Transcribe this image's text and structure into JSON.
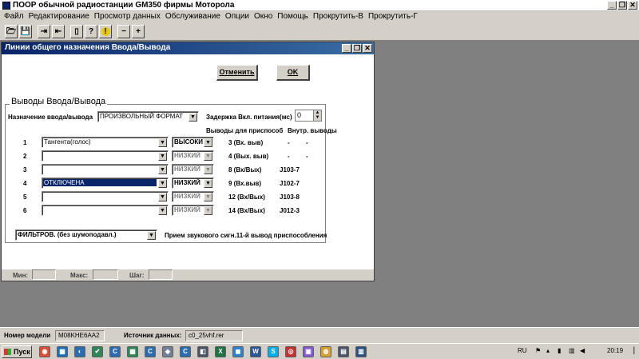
{
  "app": {
    "title": "ПООР обычной радиостанции GM350 фирмы Моторола"
  },
  "window_buttons": {
    "minimize": "_",
    "restore": "❐",
    "close": "✕"
  },
  "menu": {
    "items": [
      "Файл",
      "Редактирование",
      "Просмотр данных",
      "Обслуживание",
      "Опции",
      "Окно",
      "Помощь",
      "Прокрутить-В",
      "Прокрутить-Г"
    ]
  },
  "toolbar": {
    "buttons": [
      {
        "name": "open-icon",
        "glyph": "🗁"
      },
      {
        "name": "save-icon",
        "glyph": "💾"
      },
      {
        "name": "read-radio-icon",
        "glyph": "⇥"
      },
      {
        "name": "write-radio-icon",
        "glyph": "⇤"
      },
      {
        "name": "preview-icon",
        "glyph": "▯"
      },
      {
        "name": "help-icon",
        "glyph": "?"
      },
      {
        "name": "info-icon",
        "glyph": "!"
      },
      {
        "name": "minus-icon",
        "glyph": "−"
      },
      {
        "name": "plus-icon",
        "glyph": "+"
      }
    ]
  },
  "child_window": {
    "title": "Линии общего назначения Ввода/Вывода",
    "cancel_label": "Отменить",
    "ok_label": "OK",
    "group_title": "Выводы Ввода/Вывода",
    "purpose_label": "Назначение ввода/вывода",
    "purpose_value": "ПРОИЗВОЛЬНЫЙ ФОРМАТ",
    "delay_label": "Задержка Вкл. питания(мс)",
    "delay_value": "0",
    "accessory_pins_header": "Выводы для приспособ",
    "internal_pins_header": "Внутр. выводы",
    "rows": [
      {
        "num": "1",
        "function": "Тангента(голос)",
        "function_disabled": false,
        "function_selected": false,
        "level": "ВЫСОКИ",
        "level_disabled": false,
        "pin": "3  (Вх. выв)",
        "internal": "-",
        "internal2": "-"
      },
      {
        "num": "2",
        "function": "",
        "function_disabled": false,
        "function_selected": false,
        "level": "НИЗКИЙ",
        "level_disabled": true,
        "pin": "4  (Вых. выв)",
        "internal": "-",
        "internal2": "-"
      },
      {
        "num": "3",
        "function": "",
        "function_disabled": false,
        "function_selected": false,
        "level": "НИЗКИЙ",
        "level_disabled": true,
        "pin": "8  (Вх/Вых)",
        "internal": "J103-7",
        "internal2": ""
      },
      {
        "num": "4",
        "function": "ОТКЛЮЧЕНА",
        "function_disabled": false,
        "function_selected": true,
        "level": "НИЗКИЙ",
        "level_disabled": false,
        "pin": "9  (Вх.выв)",
        "internal": "J102-7",
        "internal2": ""
      },
      {
        "num": "5",
        "function": "",
        "function_disabled": false,
        "function_selected": false,
        "level": "НИЗКИЙ",
        "level_disabled": true,
        "pin": "12  (Вх/Вых)",
        "internal": "J103-8",
        "internal2": ""
      },
      {
        "num": "6",
        "function": "",
        "function_disabled": false,
        "function_selected": false,
        "level": "НИЗКИЙ",
        "level_disabled": true,
        "pin": "14  (Вх/Вых)",
        "internal": "J012-3",
        "internal2": ""
      }
    ],
    "filter_value": "ФИЛЬТРОВ. (без шумоподавл.)",
    "filter_caption": "Прием звукового сигн.11-й вывод приспособления",
    "min_label": "Мин:",
    "max_label": "Макс:",
    "step_label": "Шаг:"
  },
  "statusbar": {
    "model_label": "Номер модели",
    "model_value": "M08KHE6AA2",
    "source_label": "Источник данных:",
    "source_value": "c0_25vhf.rer"
  },
  "taskbar": {
    "start_label": "Пуск",
    "apps": [
      {
        "name": "chrome-icon",
        "glyph": "◉",
        "color": "#dd4b39"
      },
      {
        "name": "app-icon",
        "glyph": "▦",
        "color": "#1e6fb8"
      },
      {
        "name": "app-icon",
        "glyph": "◐",
        "color": "#2b6cb0"
      },
      {
        "name": "app-icon",
        "glyph": "✔",
        "color": "#2f855a"
      },
      {
        "name": "ccleaner-icon",
        "glyph": "C",
        "color": "#2b6cb0"
      },
      {
        "name": "app-icon",
        "glyph": "▦",
        "color": "#2f855a"
      },
      {
        "name": "ccleaner-icon",
        "glyph": "C",
        "color": "#2b6cb0"
      },
      {
        "name": "app-icon",
        "glyph": "◆",
        "color": "#718096"
      },
      {
        "name": "ccleaner-icon",
        "glyph": "C",
        "color": "#2b6cb0"
      },
      {
        "name": "app-icon",
        "glyph": "◧",
        "color": "#4a5568"
      },
      {
        "name": "excel-icon",
        "glyph": "X",
        "color": "#207245"
      },
      {
        "name": "app-icon",
        "glyph": "◼",
        "color": "#3182ce"
      },
      {
        "name": "word-icon",
        "glyph": "W",
        "color": "#2b579a"
      },
      {
        "name": "skype-icon",
        "glyph": "S",
        "color": "#00aff0"
      },
      {
        "name": "app-icon",
        "glyph": "◎",
        "color": "#c53030"
      },
      {
        "name": "app-icon",
        "glyph": "▣",
        "color": "#805ad5"
      },
      {
        "name": "app-icon",
        "glyph": "◍",
        "color": "#d69e2e"
      },
      {
        "name": "app-icon",
        "glyph": "▤",
        "color": "#4a5568"
      },
      {
        "name": "app-icon",
        "glyph": "▥",
        "color": "#2c5282"
      }
    ],
    "lang": "RU",
    "clock": "20:19"
  }
}
